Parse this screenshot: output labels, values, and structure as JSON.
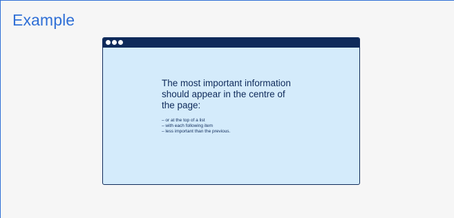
{
  "card": {
    "title": "Example"
  },
  "window": {
    "heading": "The most important information should appear in the centre of the page:",
    "bullets": [
      "– or at the top of a list",
      "– with each following item",
      "– less important than the previous."
    ]
  },
  "colors": {
    "accent": "#2f6fd6",
    "navy": "#0e2a5a",
    "window_background": "#d4ebfb",
    "card_background": "#f6f6f6"
  },
  "icons": {
    "window_controls": [
      "window-dot-icon",
      "window-dot-icon",
      "window-dot-icon"
    ]
  }
}
